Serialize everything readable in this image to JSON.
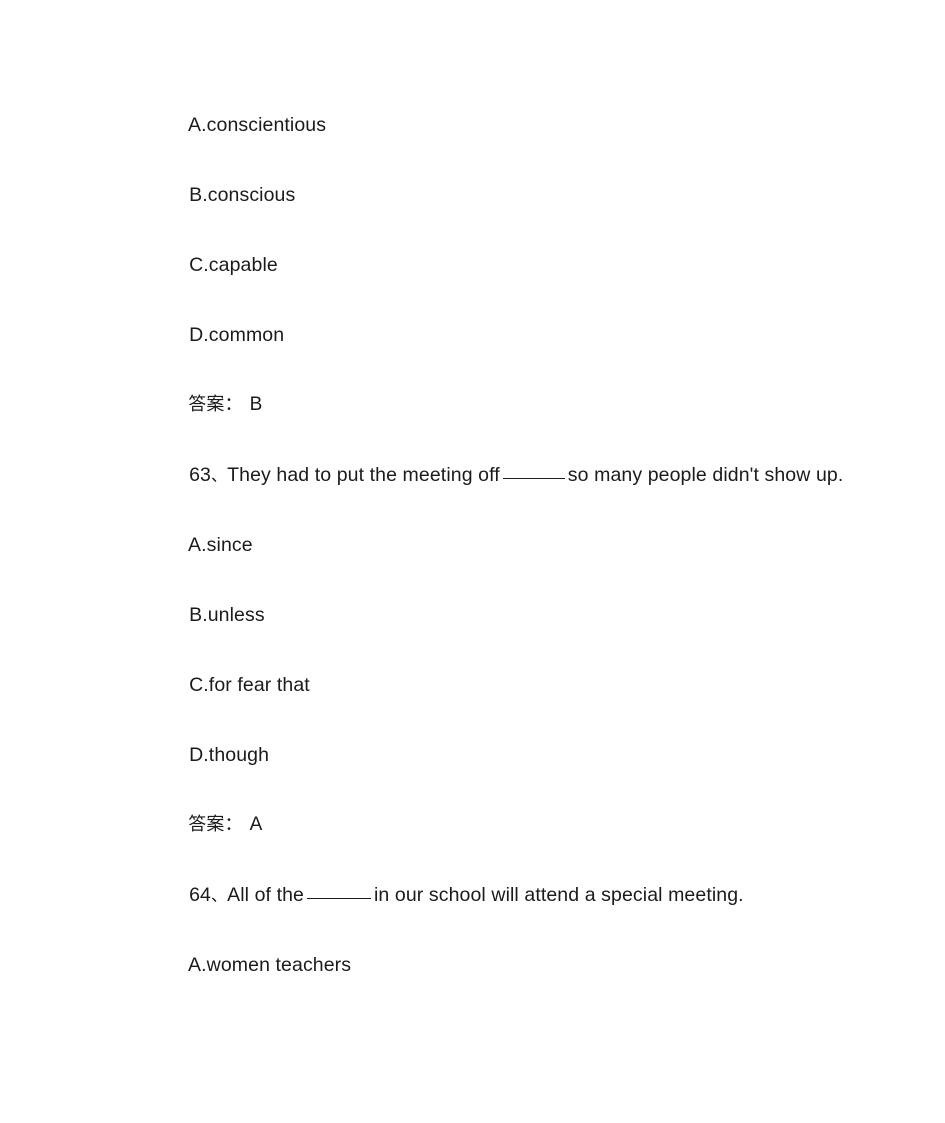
{
  "document": {
    "background_color": "#ffffff",
    "text_color": "#1b1b1b",
    "answer_label": "答案：",
    "enumeration_mark": "、"
  },
  "blocks": [
    {
      "kind": "option",
      "name": "option-a-q62",
      "text": "A.conscientious"
    },
    {
      "kind": "option",
      "name": "option-b-q62",
      "text": "B.conscious"
    },
    {
      "kind": "option",
      "name": "option-c-q62",
      "text": "C.capable"
    },
    {
      "kind": "option",
      "name": "option-d-q62",
      "text": "D.common"
    },
    {
      "kind": "answer",
      "name": "answer-q62",
      "label": "答案：",
      "value": "B"
    },
    {
      "kind": "question",
      "name": "question-63",
      "number": "63",
      "mark": "、",
      "text_before_blank": "They had to put the meeting off",
      "text_after_blank": "so many people didn't show up.",
      "full_text": "63、They had to put the meeting off ______ so many people didn't show up."
    },
    {
      "kind": "option",
      "name": "option-a-q63",
      "text": "A.since"
    },
    {
      "kind": "option",
      "name": "option-b-q63",
      "text": "B.unless"
    },
    {
      "kind": "option",
      "name": "option-c-q63",
      "text": "C.for fear that"
    },
    {
      "kind": "option",
      "name": "option-d-q63",
      "text": "D.though"
    },
    {
      "kind": "answer",
      "name": "answer-q63",
      "label": "答案：",
      "value": "A"
    },
    {
      "kind": "question",
      "name": "question-64",
      "number": "64",
      "mark": "、",
      "text_before_blank": "All of the",
      "text_after_blank": "in our school will attend a special meeting.",
      "full_text": "64、All of the ______ in our school will attend a special meeting."
    },
    {
      "kind": "option",
      "name": "option-a-q64",
      "text": "A.women teachers"
    }
  ]
}
